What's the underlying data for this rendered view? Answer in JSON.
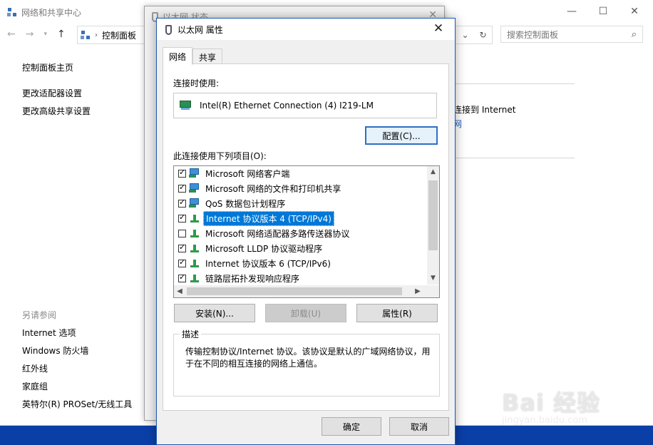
{
  "control_panel": {
    "title": "网络和共享中心",
    "breadcrumb": "控制面板",
    "search_placeholder": "搜索控制面板",
    "home": "控制面板主页",
    "side_links": [
      "更改适配器设置",
      "更改高级共享设置"
    ],
    "see_also_heading": "另请参阅",
    "see_also": [
      "Internet 选项",
      "Windows 防火墙",
      "红外线",
      "家庭组",
      "英特尔(R) PROSet/无线工具"
    ],
    "right_text": "连接到 Internet",
    "right_link": "网",
    "controls": {
      "minimize": "—",
      "maximize": "☐",
      "close": "✕"
    }
  },
  "status_dialog": {
    "title": "以太网 状态",
    "close": "✕"
  },
  "dialog": {
    "title": "以太网 属性",
    "close": "✕",
    "tabs": [
      "网络",
      "共享"
    ],
    "connect_label": "连接时使用:",
    "adapter": "Intel(R) Ethernet Connection (4) I219-LM",
    "configure": "配置(C)...",
    "items_label": "此连接使用下列项目(O):",
    "items": [
      {
        "label": "Microsoft 网络客户端",
        "checked": true,
        "icon": "network-client-icon"
      },
      {
        "label": "Microsoft 网络的文件和打印机共享",
        "checked": true,
        "icon": "file-sharing-icon"
      },
      {
        "label": "QoS 数据包计划程序",
        "checked": true,
        "icon": "qos-icon"
      },
      {
        "label": "Internet 协议版本 4 (TCP/IPv4)",
        "checked": true,
        "icon": "protocol-icon",
        "selected": true
      },
      {
        "label": "Microsoft 网络适配器多路传送器协议",
        "checked": false,
        "icon": "protocol-icon"
      },
      {
        "label": "Microsoft LLDP 协议驱动程序",
        "checked": true,
        "icon": "protocol-icon"
      },
      {
        "label": "Internet 协议版本 6 (TCP/IPv6)",
        "checked": true,
        "icon": "protocol-icon"
      },
      {
        "label": "链路层拓扑发现响应程序",
        "checked": true,
        "icon": "protocol-icon"
      }
    ],
    "install": "安装(N)...",
    "uninstall": "卸载(U)",
    "properties": "属性(R)",
    "description_title": "描述",
    "description": "传输控制协议/Internet 协议。该协议是默认的广域网络协议，用于在不同的相互连接的网络上通信。",
    "ok": "确定",
    "cancel": "取消"
  },
  "watermark": {
    "brand": "Bai 经验",
    "url": "jingyan.baidu.com"
  },
  "colors": {
    "accent": "#0078d7",
    "desktop": "#0b3fa8",
    "dialog_bg": "#f0f0f0"
  }
}
